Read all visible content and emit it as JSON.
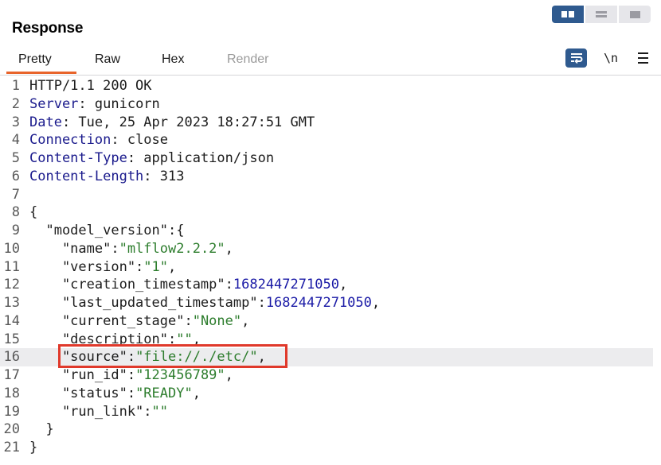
{
  "panel": {
    "title": "Response"
  },
  "tabs": [
    {
      "label": "Pretty",
      "active": true
    },
    {
      "label": "Raw"
    },
    {
      "label": "Hex"
    },
    {
      "label": "Render",
      "disabled": true
    }
  ],
  "toolbar": {
    "newline_label": "\\n"
  },
  "lines": [
    {
      "num": "1",
      "parts": [
        {
          "t": "HTTP/1.1 200 OK",
          "c": "k"
        }
      ]
    },
    {
      "num": "2",
      "parts": [
        {
          "t": "Server",
          "c": "hk"
        },
        {
          "t": ": gunicorn",
          "c": "k"
        }
      ]
    },
    {
      "num": "3",
      "parts": [
        {
          "t": "Date",
          "c": "hk"
        },
        {
          "t": ": Tue, 25 Apr 2023 18:27:51 GMT",
          "c": "k"
        }
      ]
    },
    {
      "num": "4",
      "parts": [
        {
          "t": "Connection",
          "c": "hk"
        },
        {
          "t": ": close",
          "c": "k"
        }
      ]
    },
    {
      "num": "5",
      "parts": [
        {
          "t": "Content-Type",
          "c": "hk"
        },
        {
          "t": ": application/json",
          "c": "k"
        }
      ]
    },
    {
      "num": "6",
      "parts": [
        {
          "t": "Content-Length",
          "c": "hk"
        },
        {
          "t": ": 313",
          "c": "k"
        }
      ]
    },
    {
      "num": "7",
      "parts": []
    },
    {
      "num": "8",
      "parts": [
        {
          "t": "{",
          "c": "k"
        }
      ]
    },
    {
      "num": "9",
      "parts": [
        {
          "t": "  \"model_version\":{",
          "c": "k"
        }
      ]
    },
    {
      "num": "10",
      "parts": [
        {
          "t": "    \"name\":",
          "c": "k"
        },
        {
          "t": "\"mlflow2.2.2\"",
          "c": "s"
        },
        {
          "t": ",",
          "c": "k"
        }
      ]
    },
    {
      "num": "11",
      "parts": [
        {
          "t": "    \"version\":",
          "c": "k"
        },
        {
          "t": "\"1\"",
          "c": "s"
        },
        {
          "t": ",",
          "c": "k"
        }
      ]
    },
    {
      "num": "12",
      "parts": [
        {
          "t": "    \"creation_timestamp\":",
          "c": "k"
        },
        {
          "t": "1682447271050",
          "c": "n"
        },
        {
          "t": ",",
          "c": "k"
        }
      ]
    },
    {
      "num": "13",
      "parts": [
        {
          "t": "    \"last_updated_timestamp\":",
          "c": "k"
        },
        {
          "t": "1682447271050",
          "c": "n"
        },
        {
          "t": ",",
          "c": "k"
        }
      ]
    },
    {
      "num": "14",
      "parts": [
        {
          "t": "    \"current_stage\":",
          "c": "k"
        },
        {
          "t": "\"None\"",
          "c": "s"
        },
        {
          "t": ",",
          "c": "k"
        }
      ]
    },
    {
      "num": "15",
      "parts": [
        {
          "t": "    \"description\":",
          "c": "k"
        },
        {
          "t": "\"\"",
          "c": "s"
        },
        {
          "t": ",",
          "c": "k"
        }
      ]
    },
    {
      "num": "16",
      "highlight": true,
      "parts": [
        {
          "t": "    \"source\":",
          "c": "k"
        },
        {
          "t": "\"file://./etc/\"",
          "c": "s"
        },
        {
          "t": ",",
          "c": "k"
        }
      ]
    },
    {
      "num": "17",
      "parts": [
        {
          "t": "    \"run_id\":",
          "c": "k"
        },
        {
          "t": "\"123456789\"",
          "c": "s"
        },
        {
          "t": ",",
          "c": "k"
        }
      ]
    },
    {
      "num": "18",
      "parts": [
        {
          "t": "    \"status\":",
          "c": "k"
        },
        {
          "t": "\"READY\"",
          "c": "s"
        },
        {
          "t": ",",
          "c": "k"
        }
      ]
    },
    {
      "num": "19",
      "parts": [
        {
          "t": "    \"run_link\":",
          "c": "k"
        },
        {
          "t": "\"\"",
          "c": "s"
        }
      ]
    },
    {
      "num": "20",
      "parts": [
        {
          "t": "  }",
          "c": "k"
        }
      ]
    },
    {
      "num": "21",
      "parts": [
        {
          "t": "}",
          "c": "k"
        }
      ]
    }
  ],
  "colors": {
    "accent": "#2f5a8f",
    "tab_underline": "#e8642b",
    "annotation_box": "#e0392b",
    "string": "#2d7d2d",
    "number": "#1a1aa6"
  }
}
